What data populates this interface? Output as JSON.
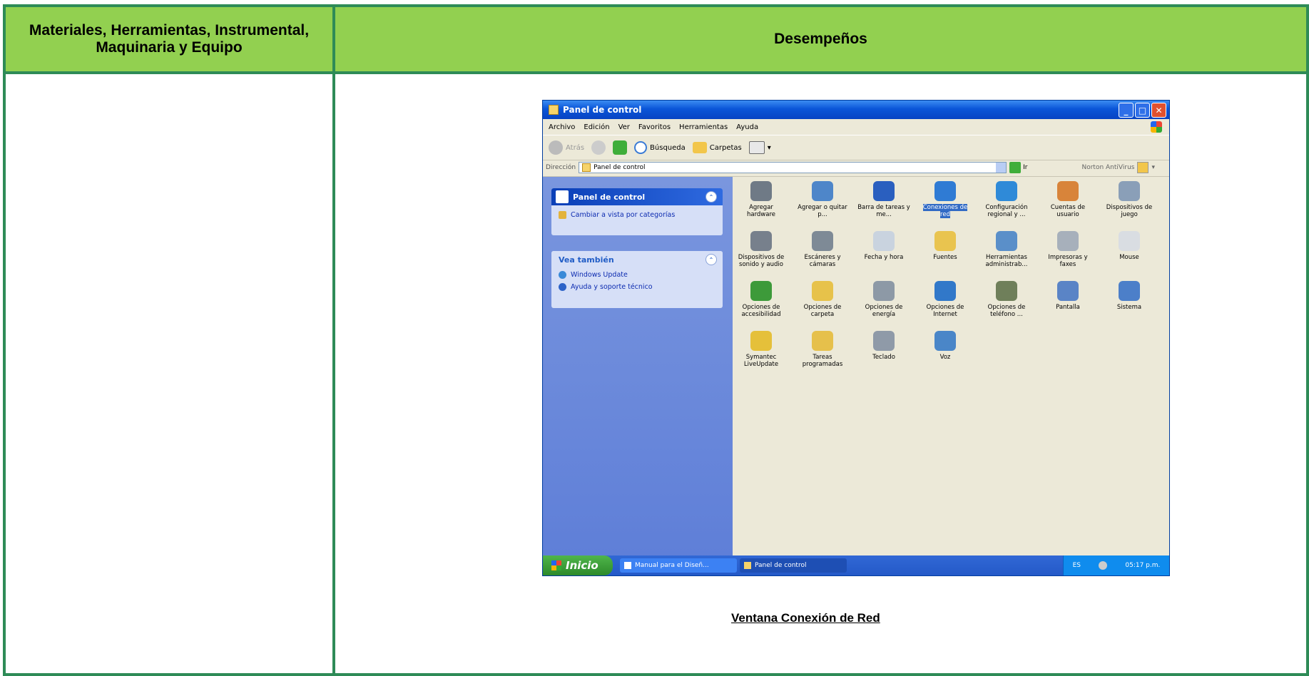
{
  "table": {
    "header_left": "Materiales, Herramientas, Instrumental, Maquinaria y Equipo",
    "header_right": "Desempeños",
    "caption": "Ventana Conexión de Red"
  },
  "window": {
    "title": "Panel de control",
    "menu": [
      "Archivo",
      "Edición",
      "Ver",
      "Favoritos",
      "Herramientas",
      "Ayuda"
    ],
    "toolbar": {
      "back_label": "Atrás",
      "search_label": "Búsqueda",
      "folders_label": "Carpetas"
    },
    "address": {
      "label": "Dirección",
      "value": "Panel de control",
      "go_label": "Ir",
      "norton_label": "Norton AntiVirus"
    },
    "left_pane": {
      "panel1_title": "Panel de control",
      "panel1_link": "Cambiar a vista por categorías",
      "panel2_title": "Vea también",
      "panel2_links": [
        "Windows Update",
        "Ayuda y soporte técnico"
      ]
    },
    "icons": [
      {
        "label": "Agregar hardware",
        "icon": "hardware-icon",
        "color": "#6f7a86"
      },
      {
        "label": "Agregar o quitar p...",
        "icon": "add-remove-icon",
        "color": "#4e86c9"
      },
      {
        "label": "Barra de tareas y me...",
        "icon": "taskbar-icon",
        "color": "#2a5fbf"
      },
      {
        "label": "Conexiones de red",
        "icon": "network-icon",
        "color": "#2f7bd4",
        "selected": true
      },
      {
        "label": "Configuración regional y ...",
        "icon": "globe-icon",
        "color": "#2f8ad8"
      },
      {
        "label": "Cuentas de usuario",
        "icon": "users-icon",
        "color": "#d8843a"
      },
      {
        "label": "Dispositivos de juego",
        "icon": "gamepad-icon",
        "color": "#8a9fb8"
      },
      {
        "label": "Dispositivos de sonido y audio",
        "icon": "speaker-icon",
        "color": "#77808c"
      },
      {
        "label": "Escáneres y cámaras",
        "icon": "scanner-icon",
        "color": "#7e8a96"
      },
      {
        "label": "Fecha y hora",
        "icon": "clock-icon",
        "color": "#c9d3df"
      },
      {
        "label": "Fuentes",
        "icon": "fonts-icon",
        "color": "#e9c44f"
      },
      {
        "label": "Herramientas administrab...",
        "icon": "admin-tools-icon",
        "color": "#5a8fc9"
      },
      {
        "label": "Impresoras y faxes",
        "icon": "printer-icon",
        "color": "#a7b0bb"
      },
      {
        "label": "Mouse",
        "icon": "mouse-icon",
        "color": "#d9dde2"
      },
      {
        "label": "Opciones de accesibilidad",
        "icon": "accessibility-icon",
        "color": "#3d9a3a"
      },
      {
        "label": "Opciones de carpeta",
        "icon": "folder-options-icon",
        "color": "#e7c24a"
      },
      {
        "label": "Opciones de energía",
        "icon": "power-icon",
        "color": "#8d99a6"
      },
      {
        "label": "Opciones de Internet",
        "icon": "internet-icon",
        "color": "#3178c9"
      },
      {
        "label": "Opciones de teléfono ...",
        "icon": "phone-icon",
        "color": "#6f7f5a"
      },
      {
        "label": "Pantalla",
        "icon": "display-icon",
        "color": "#5a84c6"
      },
      {
        "label": "Sistema",
        "icon": "system-icon",
        "color": "#4c7fc9"
      },
      {
        "label": "Symantec LiveUpdate",
        "icon": "liveupdate-icon",
        "color": "#e5c03a"
      },
      {
        "label": "Tareas programadas",
        "icon": "scheduled-tasks-icon",
        "color": "#e6c04b"
      },
      {
        "label": "Teclado",
        "icon": "keyboard-icon",
        "color": "#8f9aa8"
      },
      {
        "label": "Voz",
        "icon": "speech-icon",
        "color": "#4a86c8"
      }
    ],
    "taskbar": {
      "start_label": "Inicio",
      "task1": "Manual para el Diseñ...",
      "task2": "Panel de control",
      "lang": "ES",
      "clock": "05:17 p.m."
    }
  }
}
